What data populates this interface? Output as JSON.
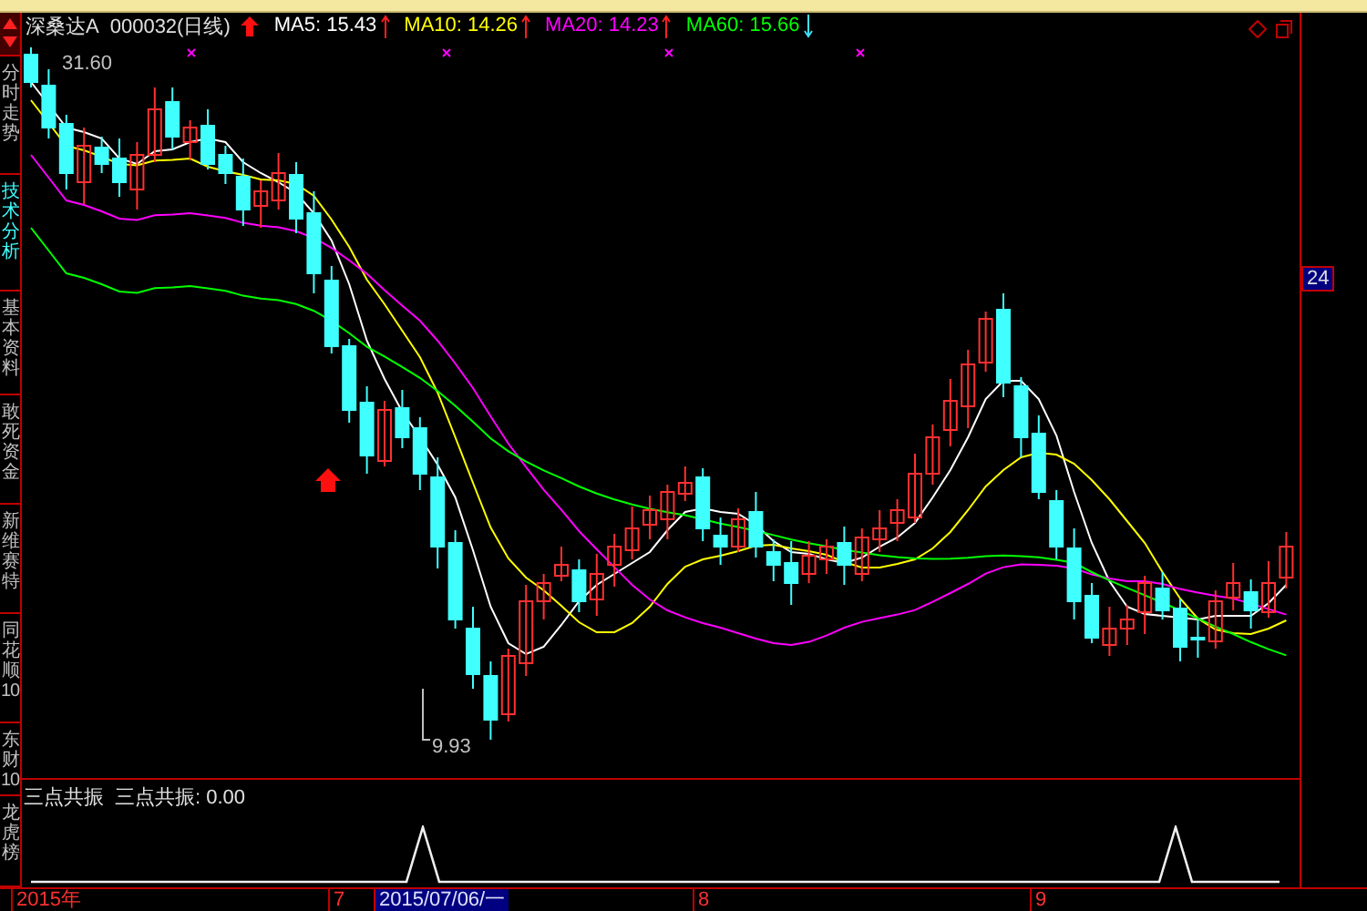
{
  "sidebar": {
    "tabs": [
      {
        "label": "分时走势",
        "selected": false
      },
      {
        "label": "技术分析",
        "selected": true
      },
      {
        "label": "基本资料",
        "selected": false
      },
      {
        "label": "敢死资金",
        "selected": false
      },
      {
        "label": "新维赛特",
        "selected": false
      },
      {
        "label": "同花顺10",
        "selected": false
      },
      {
        "label": "东财10",
        "selected": false
      },
      {
        "label": "龙虎榜",
        "selected": false
      }
    ]
  },
  "header": {
    "stock_name": "深桑达A",
    "code": "000032(日线)",
    "indicators": [
      {
        "label": "MA5: 15.43",
        "color": "#ffffff",
        "rising": true
      },
      {
        "label": "MA10: 14.26",
        "color": "#ffff00",
        "rising": true
      },
      {
        "label": "MA20: 14.23",
        "color": "#ff00ff",
        "rising": true
      },
      {
        "label": "MA60: 15.66",
        "color": "#00ff00",
        "rising": false
      }
    ]
  },
  "chart": {
    "high_label": "31.60",
    "low_label": "9.93"
  },
  "price_axis": {
    "label": "24"
  },
  "indicator_panel": {
    "title": "三点共振",
    "reading": "三点共振: 0.00"
  },
  "date_axis": [
    {
      "label": "2015年",
      "selected": false
    },
    {
      "label": "7",
      "selected": false
    },
    {
      "label": "2015/07/06/一",
      "selected": true
    },
    {
      "label": "8",
      "selected": false
    },
    {
      "label": "9",
      "selected": false
    }
  ]
}
